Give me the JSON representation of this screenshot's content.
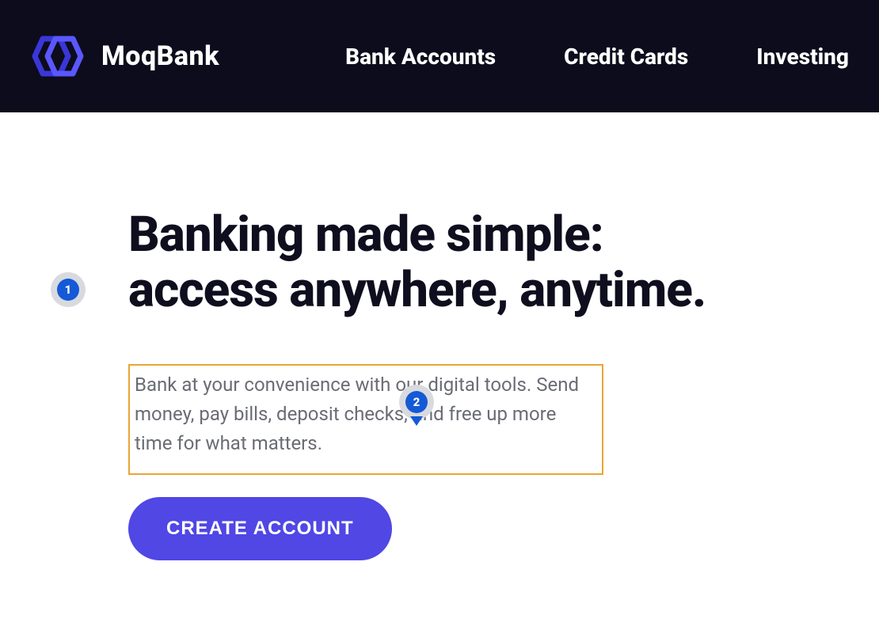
{
  "brand": {
    "name": "MoqBank"
  },
  "nav": {
    "items": [
      {
        "label": "Bank Accounts"
      },
      {
        "label": "Credit Cards"
      },
      {
        "label": "Investing"
      }
    ]
  },
  "hero": {
    "headline": "Banking made simple: access anywhere, anytime.",
    "subhead": "Bank at your convenience with our digital tools. Send money, pay bills, deposit checks, and free up more time for what matters.",
    "cta_label": "CREATE ACCOUNT"
  },
  "annotations": {
    "marker1": "1",
    "marker2": "2"
  },
  "colors": {
    "header_bg": "#0c0c1c",
    "brand_accent": "#5047e5",
    "highlight_border": "#e9a535",
    "marker_fill": "#1459d6"
  }
}
